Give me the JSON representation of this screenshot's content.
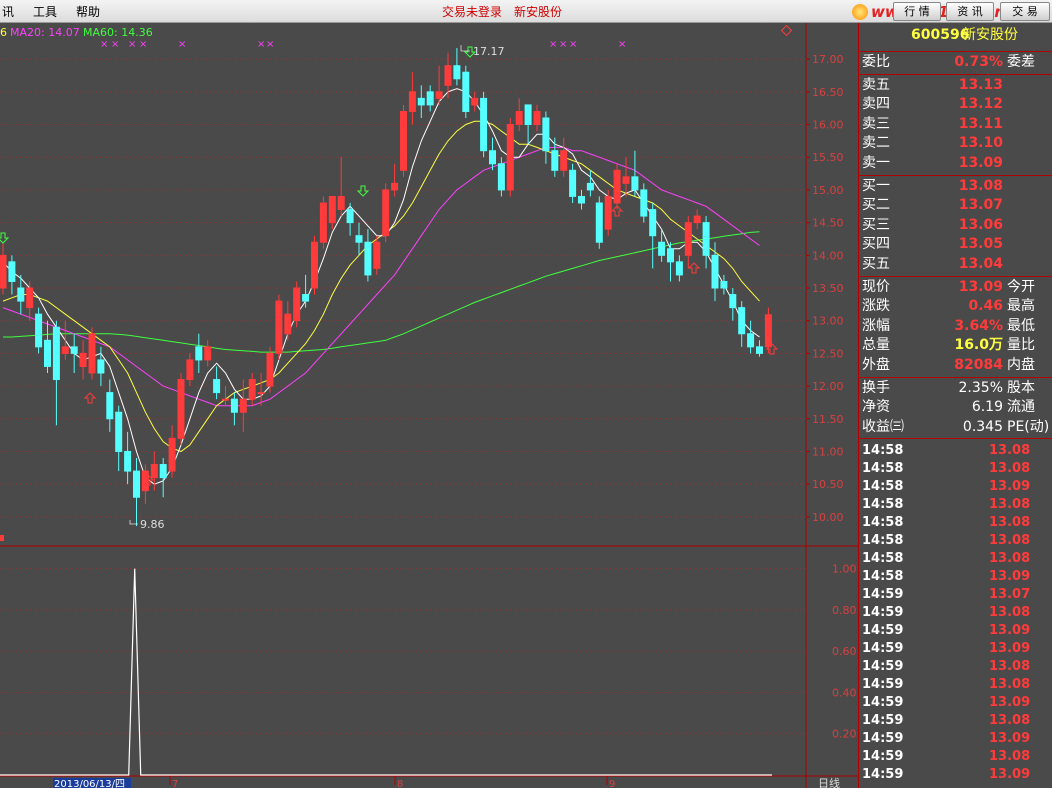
{
  "menu": {
    "info": "讯",
    "tools": "工具",
    "help": "帮助"
  },
  "status_text": "交易未登录",
  "stock_name": "新安股份",
  "buttons": {
    "market": "行 情",
    "news": "资 讯",
    "trade": "交 易"
  },
  "logo_text": "www.55188.com",
  "indicator": {
    "prefix": "6",
    "ma20": "MA20: 14.07",
    "ma60": "MA60: 14.36"
  },
  "price_labels": [
    "17.00",
    "16.50",
    "16.00",
    "15.50",
    "15.00",
    "14.50",
    "14.00",
    "13.50",
    "13.00",
    "12.50",
    "12.00",
    "11.50",
    "11.00",
    "10.50",
    "10.00"
  ],
  "lower_labels": [
    "1.00",
    "0.80",
    "0.60",
    "0.40",
    "0.20"
  ],
  "annotations": {
    "high": "17.17",
    "low": "9.86"
  },
  "date_label": "2013/06/13/四",
  "month_labels": [
    "7",
    "8",
    "9"
  ],
  "period_label": "日线",
  "quote": {
    "code": "600596",
    "name": "新安股份",
    "weibi_label": "委比",
    "weibi_value": "0.73%",
    "weicha_label": "委差",
    "asks": [
      {
        "label": "卖五",
        "price": "13.13"
      },
      {
        "label": "卖四",
        "price": "13.12"
      },
      {
        "label": "卖三",
        "price": "13.11"
      },
      {
        "label": "卖二",
        "price": "13.10"
      },
      {
        "label": "卖一",
        "price": "13.09"
      }
    ],
    "bids": [
      {
        "label": "买一",
        "price": "13.08"
      },
      {
        "label": "买二",
        "price": "13.07"
      },
      {
        "label": "买三",
        "price": "13.06"
      },
      {
        "label": "买四",
        "price": "13.05"
      },
      {
        "label": "买五",
        "price": "13.04"
      }
    ],
    "stats": [
      {
        "label": "现价",
        "value": "13.09",
        "label2": "今开",
        "color": "red"
      },
      {
        "label": "涨跌",
        "value": "0.46",
        "label2": "最高",
        "color": "red"
      },
      {
        "label": "涨幅",
        "value": "3.64%",
        "label2": "最低",
        "color": "red"
      },
      {
        "label": "总量",
        "value": "16.0万",
        "label2": "量比",
        "color": "yellow"
      },
      {
        "label": "外盘",
        "value": "82084",
        "label2": "内盘",
        "color": "red"
      }
    ],
    "extra": [
      {
        "label": "换手",
        "value": "2.35%",
        "label2": "股本"
      },
      {
        "label": "净资",
        "value": "6.19",
        "label2": "流通"
      },
      {
        "label": "收益㈢",
        "value": "0.345",
        "label2": "PE(动)"
      }
    ]
  },
  "ticks": [
    {
      "time": "14:58",
      "price": "13.08"
    },
    {
      "time": "14:58",
      "price": "13.08"
    },
    {
      "time": "14:58",
      "price": "13.09"
    },
    {
      "time": "14:58",
      "price": "13.08"
    },
    {
      "time": "14:58",
      "price": "13.08"
    },
    {
      "time": "14:58",
      "price": "13.08"
    },
    {
      "time": "14:58",
      "price": "13.08"
    },
    {
      "time": "14:58",
      "price": "13.09"
    },
    {
      "time": "14:59",
      "price": "13.07"
    },
    {
      "time": "14:59",
      "price": "13.08"
    },
    {
      "time": "14:59",
      "price": "13.09"
    },
    {
      "time": "14:59",
      "price": "13.09"
    },
    {
      "time": "14:59",
      "price": "13.08"
    },
    {
      "time": "14:59",
      "price": "13.08"
    },
    {
      "time": "14:59",
      "price": "13.09"
    },
    {
      "time": "14:59",
      "price": "13.08"
    },
    {
      "time": "14:59",
      "price": "13.09"
    },
    {
      "time": "14:59",
      "price": "13.08"
    },
    {
      "time": "14:59",
      "price": "13.09"
    },
    {
      "time": "14:59",
      "price": "13.08"
    }
  ],
  "colors": {
    "up": "#ff3b3b",
    "down": "#55ffff",
    "ma5": "#ffffff",
    "ma10": "#ffff40",
    "ma20": "#ff40ff",
    "ma60": "#40ff40",
    "border": "#b00000"
  },
  "chart_data": {
    "type": "candlestick",
    "price_range": [
      9.6,
      17.4
    ],
    "candles": [
      [
        13.5,
        14.0,
        14.2,
        13.4
      ],
      [
        13.9,
        13.6,
        14.0,
        13.4
      ],
      [
        13.5,
        13.3,
        13.7,
        13.1
      ],
      [
        13.2,
        13.5,
        13.6,
        13.0
      ],
      [
        13.1,
        12.6,
        13.2,
        12.5
      ],
      [
        12.7,
        12.3,
        13.0,
        12.2
      ],
      [
        12.9,
        12.1,
        13.0,
        11.4
      ],
      [
        12.5,
        12.6,
        13.0,
        12.4
      ],
      [
        12.6,
        12.5,
        12.8,
        12.2
      ],
      [
        12.3,
        12.5,
        12.7,
        12.1
      ],
      [
        12.2,
        12.8,
        12.9,
        12.1
      ],
      [
        12.4,
        12.2,
        12.6,
        12.0
      ],
      [
        11.9,
        11.5,
        12.1,
        11.3
      ],
      [
        11.6,
        11.0,
        11.7,
        10.7
      ],
      [
        11.0,
        10.7,
        11.3,
        10.5
      ],
      [
        10.7,
        10.3,
        10.9,
        9.86
      ],
      [
        10.4,
        10.7,
        10.8,
        10.2
      ],
      [
        10.6,
        10.8,
        11.0,
        10.4
      ],
      [
        10.8,
        10.6,
        10.9,
        10.3
      ],
      [
        10.7,
        11.2,
        11.4,
        10.6
      ],
      [
        11.2,
        12.1,
        12.2,
        11.1
      ],
      [
        12.1,
        12.4,
        12.5,
        12.0
      ],
      [
        12.6,
        12.4,
        12.8,
        12.2
      ],
      [
        12.4,
        12.6,
        12.7,
        12.3
      ],
      [
        12.1,
        11.9,
        12.3,
        11.8
      ],
      [
        11.8,
        11.8,
        12.0,
        11.7
      ],
      [
        11.8,
        11.6,
        11.9,
        11.4
      ],
      [
        11.6,
        11.8,
        12.1,
        11.3
      ],
      [
        11.8,
        12.1,
        12.2,
        11.7
      ],
      [
        11.9,
        11.9,
        12.2,
        11.7
      ],
      [
        12.0,
        12.5,
        12.6,
        11.9
      ],
      [
        12.5,
        13.3,
        13.4,
        12.4
      ],
      [
        12.8,
        13.1,
        13.3,
        12.7
      ],
      [
        13.0,
        13.5,
        13.6,
        12.9
      ],
      [
        13.4,
        13.3,
        13.7,
        13.2
      ],
      [
        13.5,
        14.2,
        14.3,
        13.4
      ],
      [
        14.2,
        14.8,
        14.9,
        14.1
      ],
      [
        14.5,
        14.9,
        14.9,
        14.4
      ],
      [
        14.7,
        14.9,
        15.5,
        14.6
      ],
      [
        14.7,
        14.5,
        14.8,
        14.3
      ],
      [
        14.3,
        14.2,
        14.5,
        14.0
      ],
      [
        14.2,
        13.7,
        14.4,
        13.6
      ],
      [
        13.8,
        14.2,
        14.3,
        13.7
      ],
      [
        14.3,
        15.0,
        15.1,
        14.2
      ],
      [
        15.0,
        15.1,
        15.4,
        14.9
      ],
      [
        15.3,
        16.2,
        16.3,
        15.2
      ],
      [
        16.2,
        16.5,
        16.8,
        16.0
      ],
      [
        16.4,
        16.3,
        16.6,
        16.1
      ],
      [
        16.5,
        16.3,
        16.6,
        16.2
      ],
      [
        16.4,
        16.5,
        16.9,
        16.3
      ],
      [
        16.6,
        16.9,
        17.1,
        16.4
      ],
      [
        16.9,
        16.7,
        17.17,
        16.6
      ],
      [
        16.8,
        16.2,
        16.9,
        16.1
      ],
      [
        16.3,
        16.4,
        16.5,
        16.2
      ],
      [
        16.4,
        15.6,
        16.5,
        15.5
      ],
      [
        15.6,
        15.4,
        15.8,
        15.3
      ],
      [
        15.4,
        15.0,
        15.5,
        14.9
      ],
      [
        15.0,
        16.0,
        16.1,
        14.9
      ],
      [
        16.0,
        16.2,
        16.4,
        15.9
      ],
      [
        16.3,
        16.0,
        16.3,
        15.7
      ],
      [
        16.0,
        16.2,
        16.3,
        15.9
      ],
      [
        16.1,
        15.6,
        16.2,
        15.4
      ],
      [
        15.6,
        15.3,
        15.8,
        15.2
      ],
      [
        15.3,
        15.6,
        15.8,
        15.2
      ],
      [
        15.3,
        14.9,
        15.4,
        14.8
      ],
      [
        14.9,
        14.8,
        15.0,
        14.7
      ],
      [
        15.1,
        15.0,
        15.3,
        14.9
      ],
      [
        14.8,
        14.2,
        14.9,
        14.1
      ],
      [
        14.4,
        14.9,
        15.0,
        14.3
      ],
      [
        14.8,
        15.3,
        15.4,
        14.7
      ],
      [
        15.1,
        15.2,
        15.5,
        14.9
      ],
      [
        15.2,
        15.0,
        15.6,
        14.9
      ],
      [
        15.0,
        14.6,
        15.1,
        14.5
      ],
      [
        14.7,
        14.3,
        14.8,
        13.8
      ],
      [
        14.2,
        14.0,
        14.4,
        13.9
      ],
      [
        14.1,
        13.9,
        14.2,
        13.6
      ],
      [
        13.9,
        13.7,
        14.0,
        13.6
      ],
      [
        14.0,
        14.5,
        14.6,
        13.8
      ],
      [
        14.5,
        14.6,
        14.7,
        14.4
      ],
      [
        14.5,
        14.0,
        14.6,
        13.8
      ],
      [
        14.0,
        13.5,
        14.2,
        13.3
      ],
      [
        13.6,
        13.5,
        13.7,
        13.4
      ],
      [
        13.4,
        13.2,
        13.5,
        13.0
      ],
      [
        13.2,
        12.8,
        13.3,
        12.6
      ],
      [
        12.8,
        12.6,
        13.0,
        12.5
      ],
      [
        12.6,
        12.5,
        12.7,
        12.45
      ],
      [
        12.6,
        13.09,
        13.2,
        12.5
      ]
    ],
    "ma5": [
      13.9,
      13.75,
      13.65,
      13.5,
      13.35,
      13.1,
      12.9,
      12.7,
      12.5,
      12.4,
      12.45,
      12.5,
      12.3,
      11.9,
      11.5,
      11.0,
      10.6,
      10.5,
      10.55,
      10.75,
      11.1,
      11.5,
      11.9,
      12.2,
      12.35,
      12.2,
      11.95,
      11.8,
      11.8,
      11.85,
      12.0,
      12.4,
      12.8,
      13.1,
      13.3,
      13.6,
      13.95,
      14.35,
      14.6,
      14.75,
      14.6,
      14.45,
      14.3,
      14.3,
      14.5,
      14.85,
      15.35,
      15.75,
      16.05,
      16.35,
      16.5,
      16.55,
      16.5,
      16.35,
      16.15,
      15.9,
      15.6,
      15.5,
      15.5,
      15.7,
      15.85,
      15.85,
      15.7,
      15.65,
      15.55,
      15.3,
      15.2,
      15.0,
      14.9,
      14.85,
      14.95,
      15.0,
      14.8,
      14.6,
      14.4,
      14.1,
      14.1,
      14.2,
      14.2,
      14.05,
      13.8,
      13.55,
      13.3,
      13.0,
      12.85,
      12.75
    ],
    "ma10": [
      13.3,
      13.35,
      13.4,
      13.4,
      13.35,
      13.3,
      13.2,
      13.1,
      13.0,
      12.9,
      12.8,
      12.7,
      12.6,
      12.4,
      12.2,
      11.9,
      11.6,
      11.35,
      11.15,
      11.05,
      11.0,
      11.1,
      11.3,
      11.5,
      11.7,
      11.8,
      11.9,
      11.95,
      12.0,
      12.05,
      12.1,
      12.2,
      12.35,
      12.5,
      12.65,
      12.85,
      13.1,
      13.4,
      13.65,
      13.85,
      14.0,
      14.15,
      14.25,
      14.35,
      14.45,
      14.6,
      14.8,
      15.05,
      15.3,
      15.55,
      15.75,
      15.9,
      16.0,
      16.05,
      16.05,
      16.0,
      15.9,
      15.8,
      15.7,
      15.7,
      15.65,
      15.6,
      15.55,
      15.5,
      15.45,
      15.4,
      15.3,
      15.2,
      15.1,
      15.0,
      14.95,
      14.9,
      14.85,
      14.8,
      14.7,
      14.55,
      14.45,
      14.35,
      14.25,
      14.15,
      14.05,
      13.95,
      13.8,
      13.6,
      13.45,
      13.3
    ],
    "ma20": [
      13.2,
      13.15,
      13.1,
      13.05,
      13.0,
      12.95,
      12.9,
      12.85,
      12.8,
      12.75,
      12.7,
      12.65,
      12.6,
      12.5,
      12.4,
      12.3,
      12.2,
      12.1,
      12.0,
      11.95,
      11.9,
      11.85,
      11.8,
      11.75,
      11.7,
      11.7,
      11.7,
      11.7,
      11.7,
      11.75,
      11.8,
      11.9,
      12.0,
      12.1,
      12.2,
      12.35,
      12.5,
      12.65,
      12.8,
      12.95,
      13.1,
      13.25,
      13.4,
      13.55,
      13.7,
      13.9,
      14.1,
      14.3,
      14.5,
      14.7,
      14.85,
      15.0,
      15.1,
      15.2,
      15.3,
      15.35,
      15.4,
      15.45,
      15.5,
      15.55,
      15.6,
      15.65,
      15.65,
      15.65,
      15.6,
      15.6,
      15.55,
      15.5,
      15.45,
      15.4,
      15.35,
      15.3,
      15.2,
      15.1,
      15.0,
      14.95,
      14.9,
      14.85,
      14.8,
      14.75,
      14.65,
      14.55,
      14.45,
      14.35,
      14.25,
      14.15
    ],
    "ma60": [
      12.75,
      12.75,
      12.76,
      12.77,
      12.78,
      12.79,
      12.8,
      12.8,
      12.8,
      12.8,
      12.8,
      12.8,
      12.8,
      12.79,
      12.78,
      12.76,
      12.74,
      12.72,
      12.7,
      12.68,
      12.66,
      12.64,
      12.62,
      12.6,
      12.58,
      12.56,
      12.55,
      12.54,
      12.53,
      12.52,
      12.52,
      12.52,
      12.52,
      12.53,
      12.54,
      12.55,
      12.56,
      12.58,
      12.6,
      12.62,
      12.64,
      12.66,
      12.68,
      12.7,
      12.75,
      12.8,
      12.86,
      12.92,
      12.98,
      13.04,
      13.1,
      13.16,
      13.22,
      13.28,
      13.33,
      13.38,
      13.43,
      13.48,
      13.53,
      13.58,
      13.63,
      13.68,
      13.72,
      13.76,
      13.8,
      13.84,
      13.88,
      13.92,
      13.95,
      13.98,
      14.01,
      14.04,
      14.07,
      14.1,
      14.13,
      14.16,
      14.19,
      14.21,
      14.23,
      14.25,
      14.27,
      14.29,
      14.31,
      14.33,
      14.35,
      14.36
    ],
    "lower": {
      "range": [
        0,
        1.1
      ],
      "spike_index": 16,
      "spike_value": 1.0
    }
  }
}
